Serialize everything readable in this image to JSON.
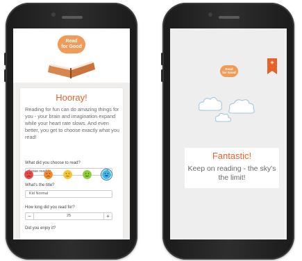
{
  "colors": {
    "brand_orange": "#e5632b",
    "logo_orange": "#f29a57",
    "background_grey": "#f0eeec",
    "selected_outline": "#1e7ac8"
  },
  "left_screen": {
    "logo": {
      "line1": "Read",
      "line2": "for Good"
    },
    "card": {
      "title": "Hooray!",
      "intro": "Reading for fun can do amazing things for you - your brain and imagination expand while your heart rate slows. And even better, you get to choose exactly what you read!",
      "q_read_label": "What did you choose to read?",
      "q_read_value": "I was read to",
      "q_title_label": "What's the title?",
      "q_title_value": "Kid Normal",
      "q_duration_label": "How long did you read for?",
      "q_duration_value": "25",
      "minus": "−",
      "plus": "+",
      "q_enjoy_label": "Did you enjoy it?",
      "faces": [
        "very-sad-face-icon",
        "sad-face-icon",
        "neutral-face-icon",
        "happy-face-icon",
        "very-happy-face-icon"
      ],
      "selected_face": "very-happy-face-icon"
    }
  },
  "right_screen": {
    "logo": {
      "line1": "Read",
      "line2": "for Good"
    },
    "bookmark_symbol": "+",
    "title": "Fantastic!",
    "message": "Keep on reading - the sky's the limit!"
  }
}
